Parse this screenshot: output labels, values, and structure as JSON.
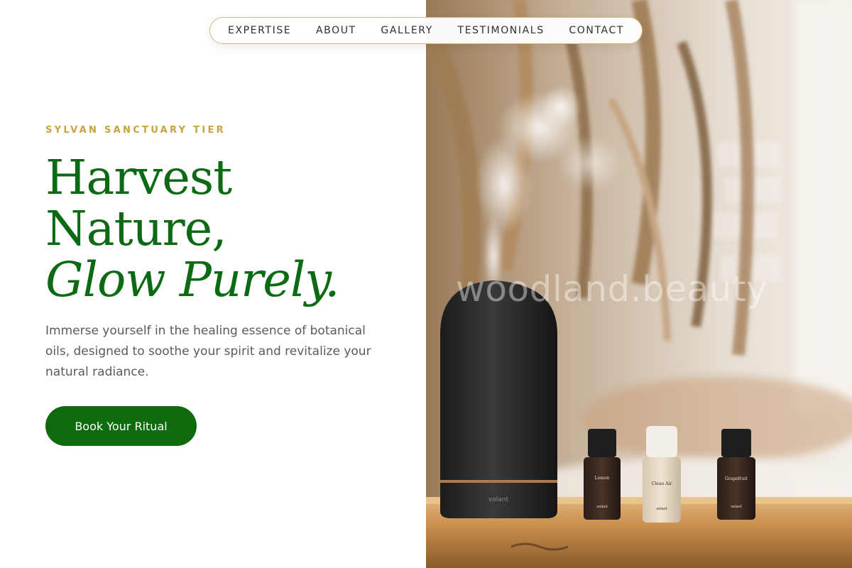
{
  "nav": {
    "items": [
      {
        "label": "EXPERTISE"
      },
      {
        "label": "ABOUT"
      },
      {
        "label": "GALLERY"
      },
      {
        "label": "TESTIMONIALS"
      },
      {
        "label": "CONTACT"
      }
    ]
  },
  "hero": {
    "eyebrow": "SYLVAN SANCTUARY TIER",
    "headline_line1": "Harvest",
    "headline_line2": "Nature,",
    "headline_line3": "Glow Purely.",
    "lede": "Immerse yourself in the healing essence of botanical oils, designed to soothe your spirit and revitalize your natural radiance.",
    "cta_label": "Book Your Ritual"
  },
  "image": {
    "watermark": "woodland.beauty",
    "diffuser_brand": "volant",
    "bottles": [
      {
        "name": "Lemon",
        "brand": "volant"
      },
      {
        "name": "Clean Air",
        "brand": "volant"
      },
      {
        "name": "Grapefruit",
        "brand": "volant"
      }
    ]
  },
  "colors": {
    "primary_green": "#0d6a14",
    "accent_gold": "#c9a43c",
    "text_gray": "#5a5a5a",
    "button_green": "#0d6a0d"
  }
}
